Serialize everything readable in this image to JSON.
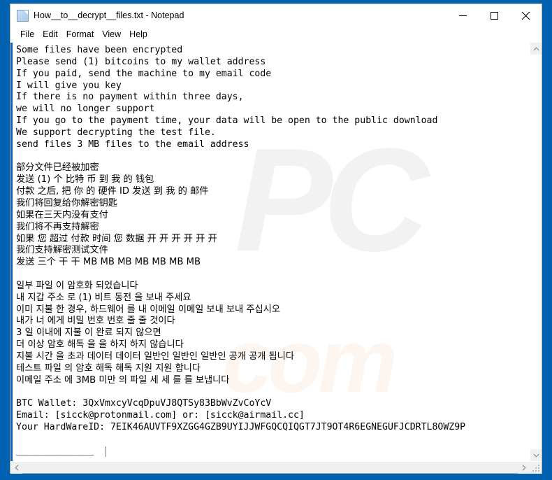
{
  "window": {
    "title": "How__to__decrypt__files.txt - Notepad",
    "app_icon": "notepad-document-icon",
    "controls": {
      "minimize_label": "Minimize",
      "maximize_label": "Maximize",
      "close_label": "Close"
    }
  },
  "menubar": {
    "items": [
      {
        "label": "File"
      },
      {
        "label": "Edit"
      },
      {
        "label": "Format"
      },
      {
        "label": "View"
      },
      {
        "label": "Help"
      }
    ]
  },
  "document": {
    "lines": [
      {
        "text": "Some files have been encrypted",
        "script": "latin"
      },
      {
        "text": "Please send (1) bitcoins to my wallet address",
        "script": "latin"
      },
      {
        "text": "If you paid, send the machine to my email code",
        "script": "latin"
      },
      {
        "text": "I will give you key",
        "script": "latin"
      },
      {
        "text": "If there is no payment within three days,",
        "script": "latin"
      },
      {
        "text": "we will no longer support",
        "script": "latin"
      },
      {
        "text": "If you go to the payment time, your data will be open to the public download",
        "script": "latin"
      },
      {
        "text": "We support decrypting the test file.",
        "script": "latin"
      },
      {
        "text": "send files 3 MB files to the email address",
        "script": "latin"
      },
      {
        "text": "",
        "script": "blank"
      },
      {
        "text": "部分文件已经被加密",
        "script": "cjk"
      },
      {
        "text": "发送 (1) 个 比特 币 到 我 的 钱包",
        "script": "cjk"
      },
      {
        "text": "付款 之后, 把 你 的 硬件 ID 发送 到 我 的 邮件",
        "script": "cjk"
      },
      {
        "text": "我们将回复给你解密钥匙",
        "script": "cjk"
      },
      {
        "text": "如果在三天内没有支付",
        "script": "cjk"
      },
      {
        "text": "我们将不再支持解密",
        "script": "cjk"
      },
      {
        "text": "如果 您 超过 付款 时间 您 数据 开 开 开 开 开 开",
        "script": "cjk"
      },
      {
        "text": "我们支持解密测试文件",
        "script": "cjk"
      },
      {
        "text": "发送 三个 干 干 MB MB MB MB MB MB MB",
        "script": "cjk"
      },
      {
        "text": "",
        "script": "blank"
      },
      {
        "text": "일부 파일 이 암호화 되었습니다",
        "script": "cjk"
      },
      {
        "text": "내 지갑 주소 로 (1) 비트 동전 을 보내 주세요",
        "script": "cjk"
      },
      {
        "text": "이미 지불 한 경우, 하드웨어 를 내 이메일 이메일 보내 보내 주십시오",
        "script": "cjk"
      },
      {
        "text": "내가 너 에게 비밀 번호 번호 줄 줄 것이다",
        "script": "cjk"
      },
      {
        "text": "3 일 이내에 지불 이 완료 되지 않으면",
        "script": "cjk"
      },
      {
        "text": "더 이상 암호 해독 을 을 하지 하지 않습니다",
        "script": "cjk"
      },
      {
        "text": "지불 시간 을 초과 데이터 데이터 일반인 일반인 일반인 공개 공개 됩니다",
        "script": "cjk"
      },
      {
        "text": "테스트 파일 의 암호 해독 해독 지원 지원 합니다",
        "script": "cjk"
      },
      {
        "text": "이메일 주소 에 3MB 미만 의 파일 세 세 를 를 보냅니다",
        "script": "cjk"
      },
      {
        "text": "",
        "script": "blank"
      },
      {
        "text": "BTC Wallet: 3QxVmxcyVcqDpuVJ8QTSy83BbWvZvCoYcV",
        "script": "latin"
      },
      {
        "text": "Email: [sicck@protonmail.com] or: [sicck@airmail.cc]",
        "script": "latin"
      },
      {
        "text": "Your HardWareID: 7EIK46AUVTF9XZGG4GZB9UYIJJWFGQCQIQGT7JT9OT4R6EGNEGUFJCDRTL8OWZ9P",
        "script": "latin"
      },
      {
        "text": "",
        "script": "blank"
      },
      {
        "text": "______________",
        "script": "latin"
      }
    ],
    "ransom_details": {
      "btc_wallet": "3QxVmxcyVcqDpuVJ8QTSy83BbWvZvCoYcV",
      "email_primary": "sicck@protonmail.com",
      "email_secondary": "sicck@airmail.cc",
      "hardware_id": "7EIK46AUVTF9XZGG4GZB9UYIJJWFGQCQIQGT7JT9OT4R6EGNEGUFJCDRTL8OWZ9P",
      "ransom_amount": "1 bitcoin",
      "deadline": "three days",
      "test_file_limit": "3 MB"
    }
  },
  "scrollbars": {
    "vertical": {
      "up_icon": "chevron-up-icon",
      "down_icon": "chevron-down-icon"
    },
    "horizontal": {
      "left_icon": "chevron-left-icon",
      "right_icon": "chevron-right-icon"
    },
    "resize_grip_icon": "resize-grip-icon"
  },
  "watermark": {
    "top_text": "PC",
    "bottom_text": "com"
  },
  "colors": {
    "desktop": "#0062b1",
    "window_bg": "#ffffff",
    "text": "#000000",
    "accent_edge": "#0a63b5",
    "scrollbar_bg": "#f0f0f0"
  }
}
